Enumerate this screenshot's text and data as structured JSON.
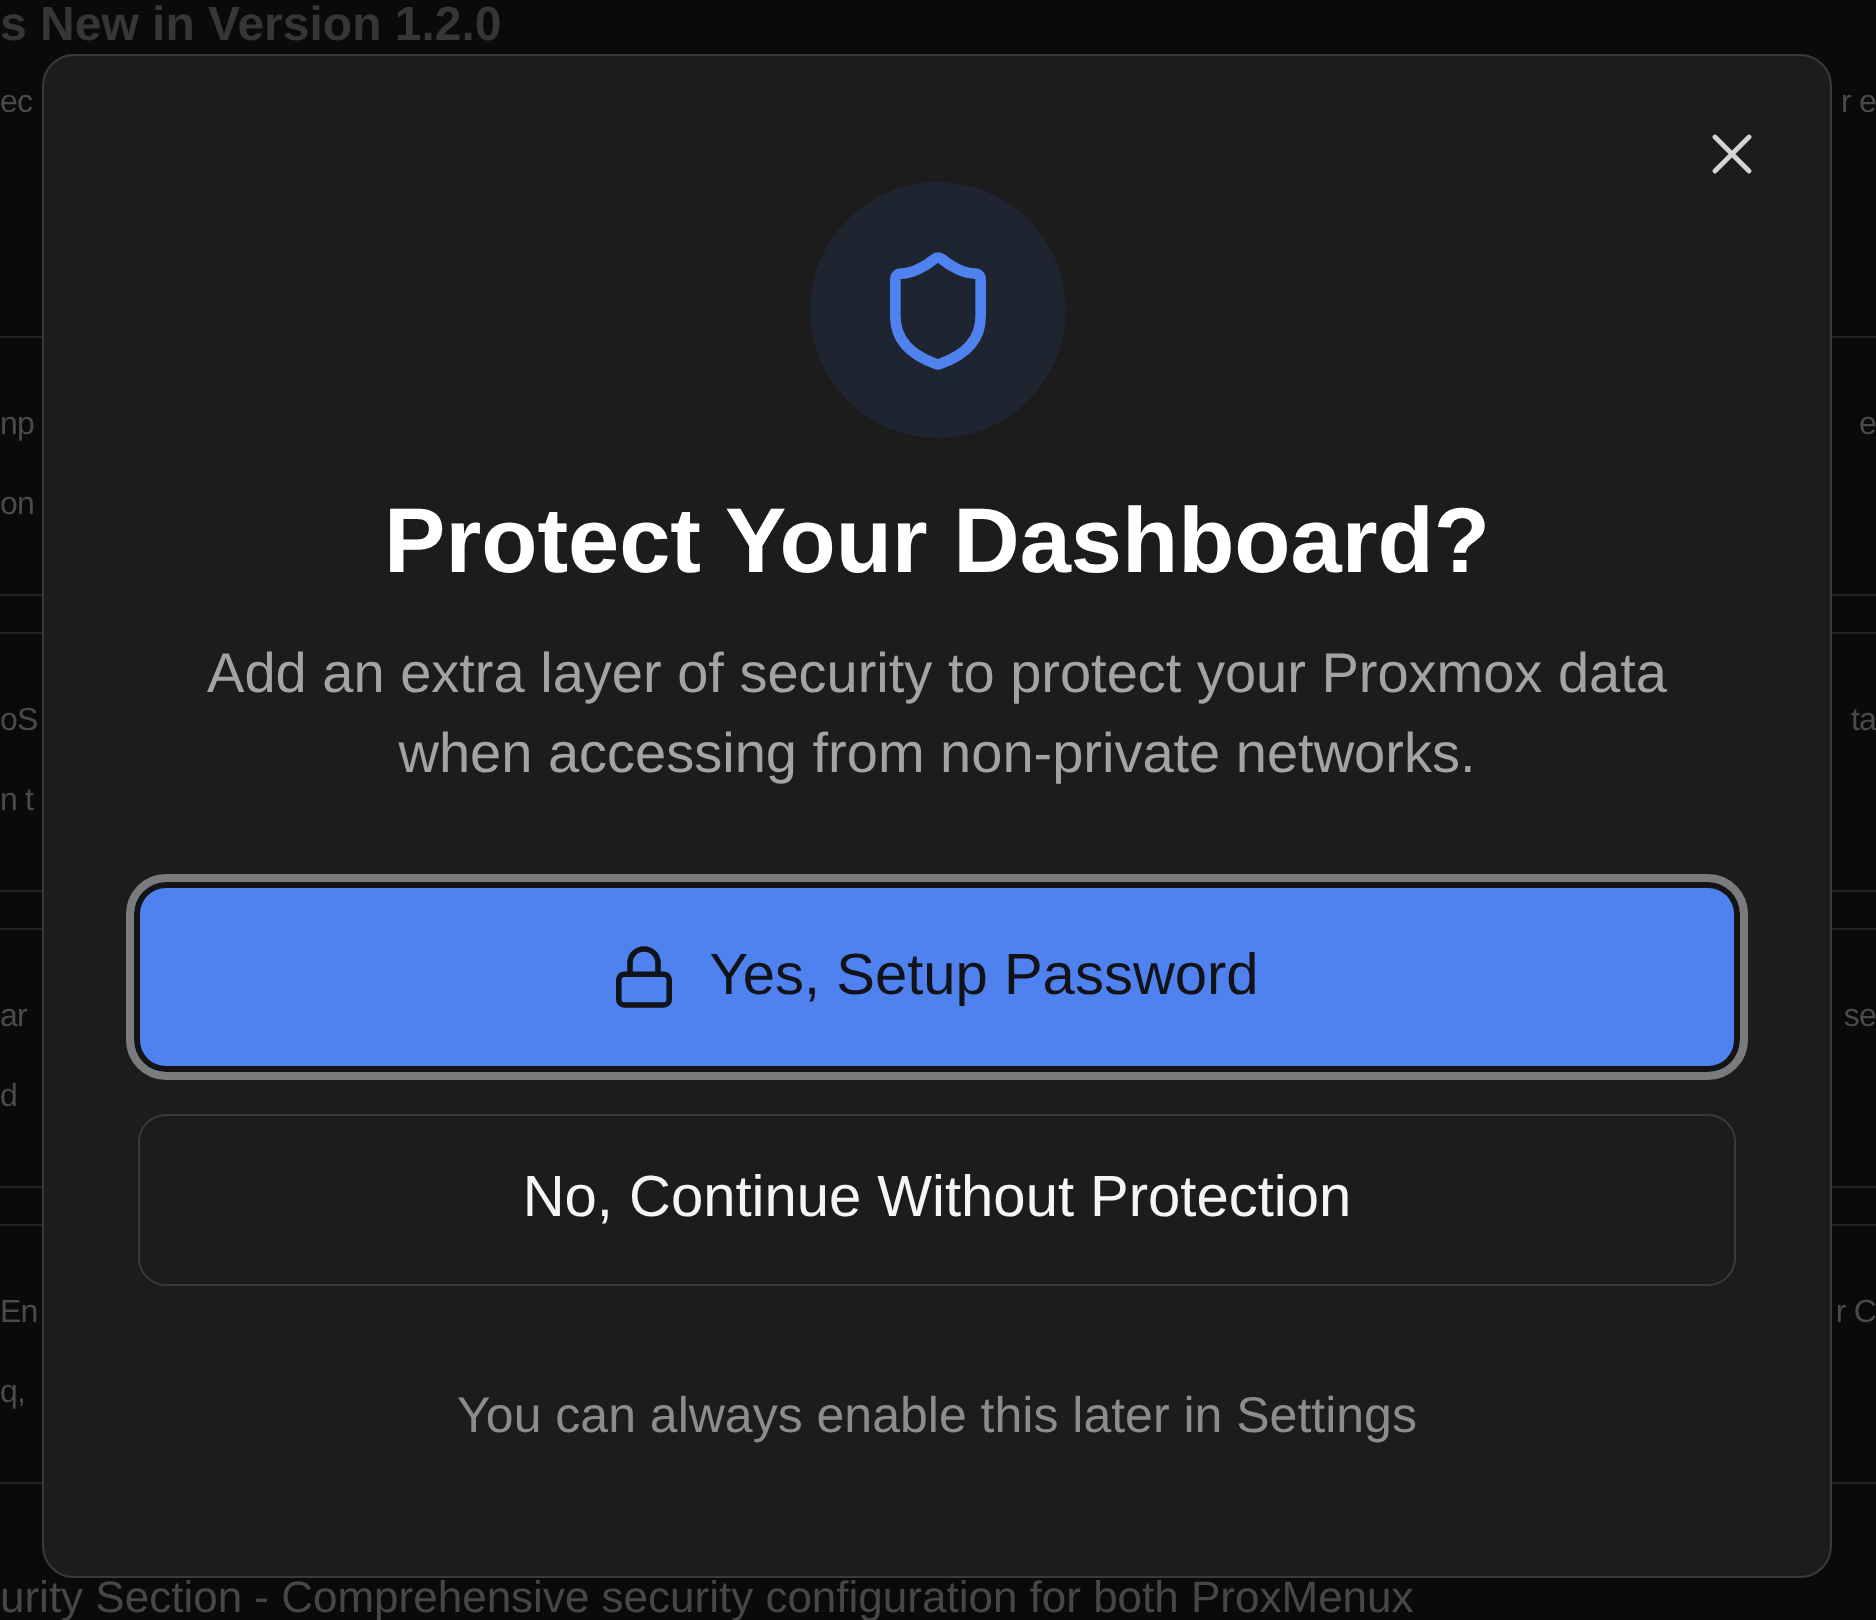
{
  "background": {
    "title": "s New in Version 1.2.0",
    "intro": {
      "left": "ec",
      "right": "r e"
    },
    "cards": [
      {
        "rows": [
          {
            "left": "np",
            "right": "e"
          },
          {
            "left": "on"
          }
        ]
      },
      {
        "rows": [
          {
            "left": "oS",
            "right": "ta"
          },
          {
            "left": "n t"
          }
        ]
      },
      {
        "rows": [
          {
            "left": "ar",
            "right": "se"
          },
          {
            "left": "d"
          }
        ]
      },
      {
        "rows": [
          {
            "left": "En",
            "right": "r C"
          },
          {
            "left": "q,"
          }
        ]
      }
    ],
    "next_heading": "urity Section - Comprehensive security configuration for both ProxMenux"
  },
  "dialog": {
    "title": "Protect Your Dashboard?",
    "message": "Add an extra layer of security to protect your Proxmox data when accessing from non-private networks.",
    "buttons": [
      {
        "kind": "primary",
        "label": "Yes, Setup Password",
        "focused": true
      },
      {
        "kind": "secondary",
        "label": "No, Continue Without Protection",
        "focused": false
      }
    ],
    "note": "You can always enable this later in Settings"
  }
}
